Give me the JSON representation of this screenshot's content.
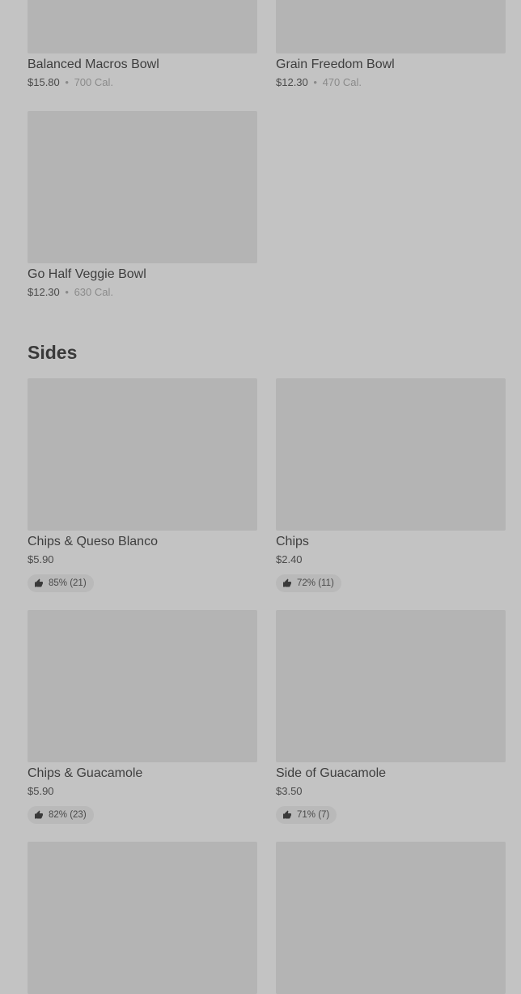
{
  "bowls": [
    {
      "name": "Balanced Macros Bowl",
      "price": "$15.80",
      "calories": "700 Cal."
    },
    {
      "name": "Grain Freedom Bowl",
      "price": "$12.30",
      "calories": "470 Cal."
    },
    {
      "name": "Go Half Veggie Bowl",
      "price": "$12.30",
      "calories": "630 Cal."
    }
  ],
  "separator": "•",
  "sides": {
    "title": "Sides",
    "items": [
      {
        "name": "Chips & Queso Blanco",
        "price": "$5.90",
        "rating": "85% (21)"
      },
      {
        "name": "Chips",
        "price": "$2.40",
        "rating": "72% (11)"
      },
      {
        "name": "Chips & Guacamole",
        "price": "$5.90",
        "rating": "82% (23)"
      },
      {
        "name": "Side of Guacamole",
        "price": "$3.50",
        "rating": "71% (7)"
      }
    ]
  },
  "colors": {
    "background": "#c3c3c3",
    "image_placeholder": "#b4b4b4",
    "badge_background": "#b9b9b9"
  }
}
